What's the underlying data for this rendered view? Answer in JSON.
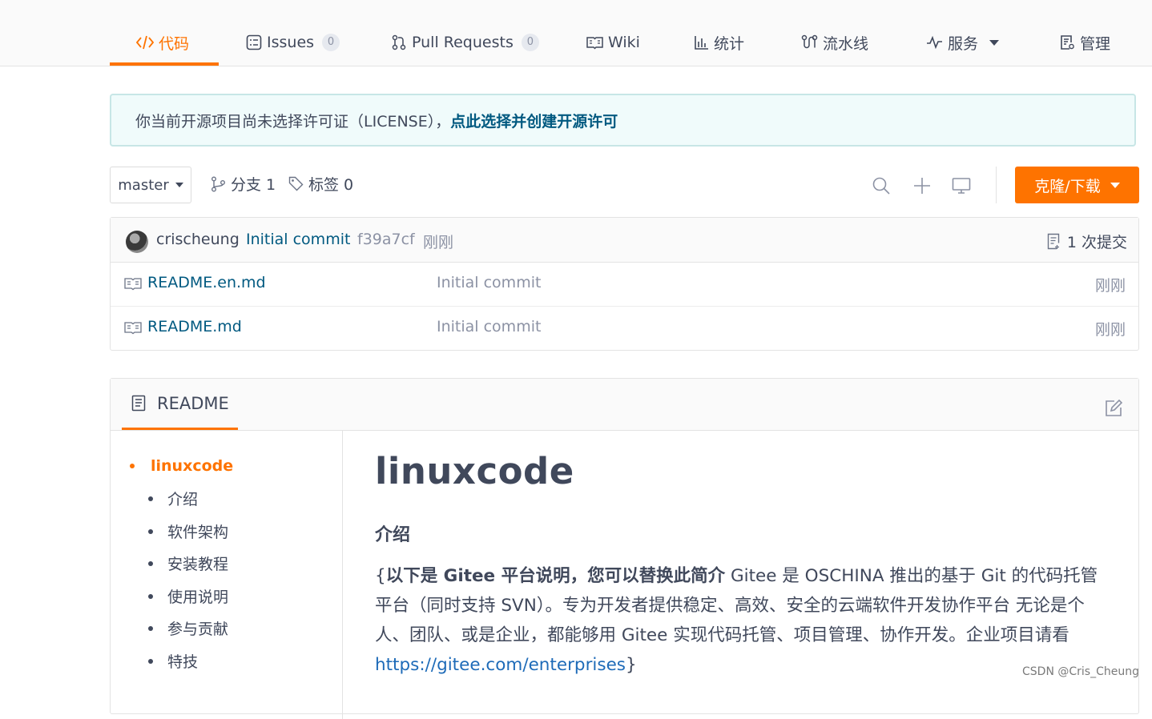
{
  "nav": {
    "items": [
      {
        "label": "代码",
        "active": true
      },
      {
        "label": "Issues",
        "count": "0"
      },
      {
        "label": "Pull Requests",
        "count": "0"
      },
      {
        "label": "Wiki"
      },
      {
        "label": "统计"
      },
      {
        "label": "流水线"
      },
      {
        "label": "服务"
      },
      {
        "label": "管理"
      }
    ]
  },
  "banner": {
    "text": "你当前开源项目尚未选择许可证（LICENSE），",
    "link": "点此选择并创建开源许可"
  },
  "toolbar": {
    "branch": "master",
    "branches_label": "分支 1",
    "tags_label": "标签 0",
    "clone_label": "克隆/下载"
  },
  "commit": {
    "author": "crischeung",
    "message": "Initial commit",
    "hash": "f39a7cf",
    "time": "刚刚",
    "count_label": "1 次提交"
  },
  "files": [
    {
      "name": "README.en.md",
      "message": "Initial commit",
      "time": "刚刚"
    },
    {
      "name": "README.md",
      "message": "Initial commit",
      "time": "刚刚"
    }
  ],
  "readme": {
    "tab_label": "README",
    "toc": [
      "linuxcode",
      "介绍",
      "软件架构",
      "安装教程",
      "使用说明",
      "参与贡献",
      "特技"
    ],
    "title": "linuxcode",
    "section": "介绍",
    "para_open": "{",
    "para_bold": "以下是 Gitee 平台说明，您可以替换此简介",
    "para_text": " Gitee 是 OSCHINA 推出的基于 Git 的代码托管平台（同时支持 SVN）。专为开发者提供稳定、高效、安全的云端软件开发协作平台 无论是个人、团队、或是企业，都能够用 Gitee 实现代码托管、项目管理、协作开发。企业项目请看 ",
    "para_link": "https://gitee.com/enterprises",
    "para_close": "}"
  },
  "watermark": "CSDN @Cris_Cheung",
  "colors": {
    "accent": "#fe7300",
    "link": "#005980",
    "text": "#40485b"
  }
}
